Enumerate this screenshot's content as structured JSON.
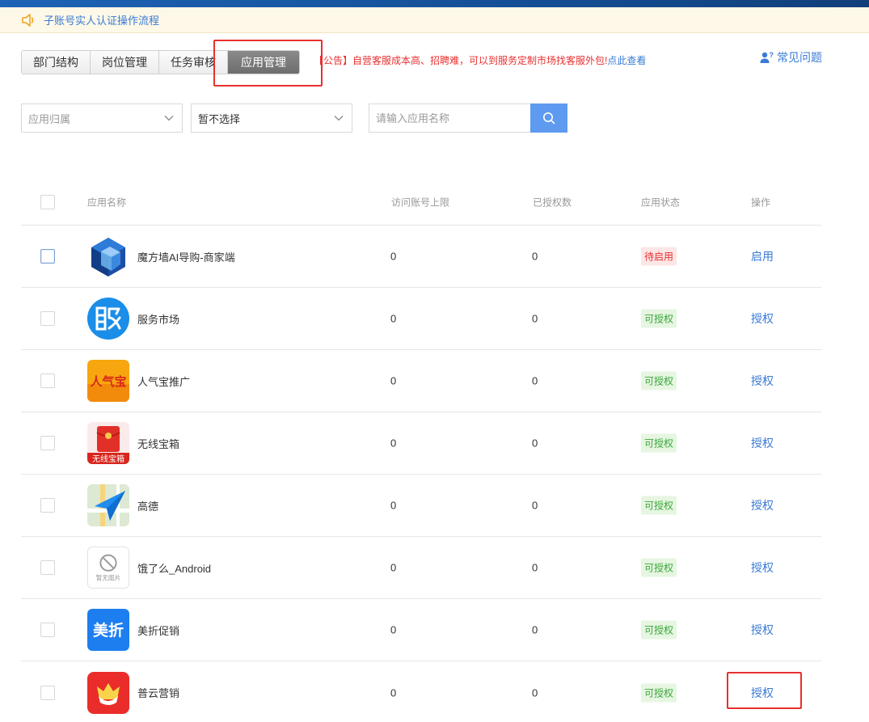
{
  "notice": {
    "text": "子账号实人认证操作流程"
  },
  "tabs": [
    {
      "label": "部门结构"
    },
    {
      "label": "岗位管理"
    },
    {
      "label": "任务审核"
    },
    {
      "label": "应用管理"
    }
  ],
  "announcement": {
    "text": "【公告】自营客服成本高、招聘难，可以到服务定制市场找客服外包!",
    "link": "点此查看"
  },
  "faq": {
    "label": "常见问题"
  },
  "filters": {
    "app_owner_placeholder": "应用归属",
    "second_select_value": "暂不选择",
    "search_placeholder": "请输入应用名称"
  },
  "table": {
    "headers": {
      "name": "应用名称",
      "limit": "访问账号上限",
      "authorized": "已授权数",
      "status": "应用状态",
      "op": "操作"
    },
    "rows": [
      {
        "name": "魔方墙AI导购-商家端",
        "limit": "0",
        "authorized": "0",
        "status": "待启用",
        "op": "启用",
        "icon": "cube-icon"
      },
      {
        "name": "服务市场",
        "limit": "0",
        "authorized": "0",
        "status": "可授权",
        "op": "授权",
        "icon": "service-market-icon"
      },
      {
        "name": "人气宝推广",
        "limit": "0",
        "authorized": "0",
        "status": "可授权",
        "op": "授权",
        "icon": "renqibao-icon",
        "logo_text": "人气宝"
      },
      {
        "name": "无线宝箱",
        "limit": "0",
        "authorized": "0",
        "status": "可授权",
        "op": "授权",
        "icon": "wireless-box-icon",
        "logo_text": "无线宝箱"
      },
      {
        "name": "高德",
        "limit": "0",
        "authorized": "0",
        "status": "可授权",
        "op": "授权",
        "icon": "amap-icon"
      },
      {
        "name": "饿了么_Android",
        "limit": "0",
        "authorized": "0",
        "status": "可授权",
        "op": "授权",
        "icon": "no-image-icon",
        "logo_text": "暂无图片"
      },
      {
        "name": "美折促销",
        "limit": "0",
        "authorized": "0",
        "status": "可授权",
        "op": "授权",
        "icon": "meizhe-icon",
        "logo_text": "美折"
      },
      {
        "name": "普云营销",
        "limit": "0",
        "authorized": "0",
        "status": "可授权",
        "op": "授权",
        "icon": "puyun-icon"
      }
    ]
  },
  "colors": {
    "link": "#3a7bd5",
    "alert": "#e8302f",
    "ok": "#3aa63a",
    "search_button": "#5e9bf0"
  }
}
